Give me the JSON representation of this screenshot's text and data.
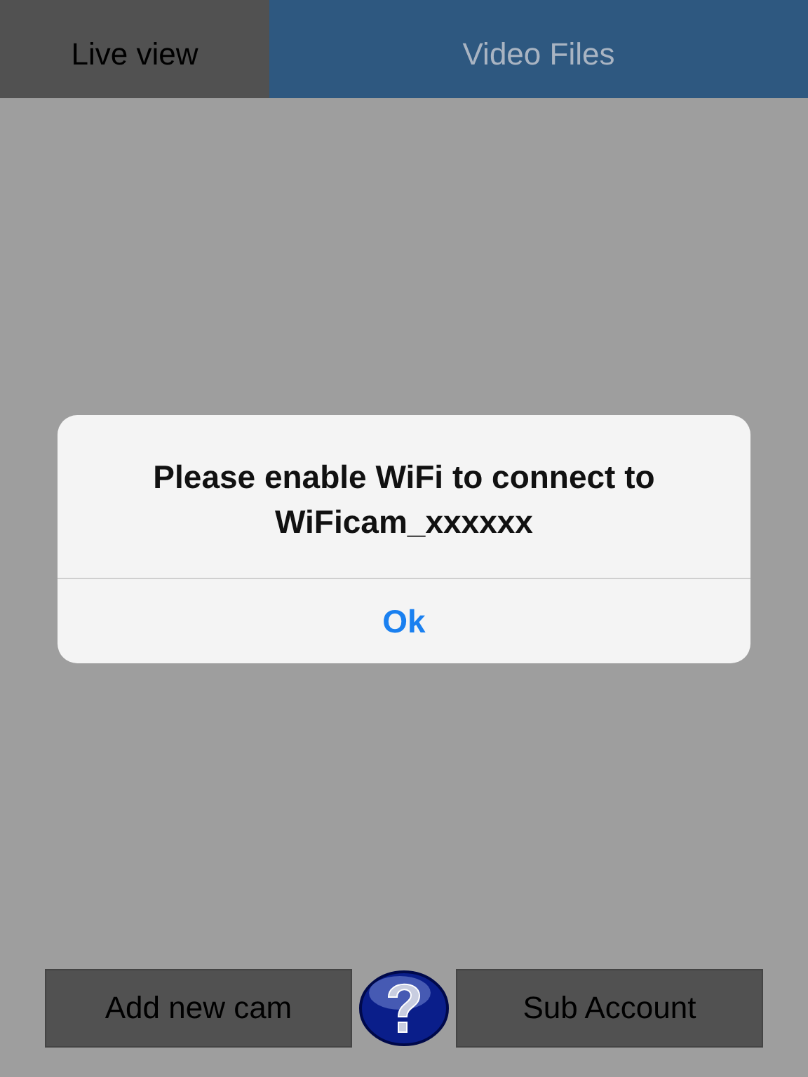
{
  "tabs": [
    {
      "label": "Live view",
      "selected": true
    },
    {
      "label": "Video Files",
      "selected": false
    }
  ],
  "alert": {
    "message": "Please enable WiFi to connect to WiFicam_xxxxxx",
    "button": "Ok"
  },
  "bottom_bar": {
    "buttons": [
      "Add new cam",
      "Sub Account"
    ]
  }
}
